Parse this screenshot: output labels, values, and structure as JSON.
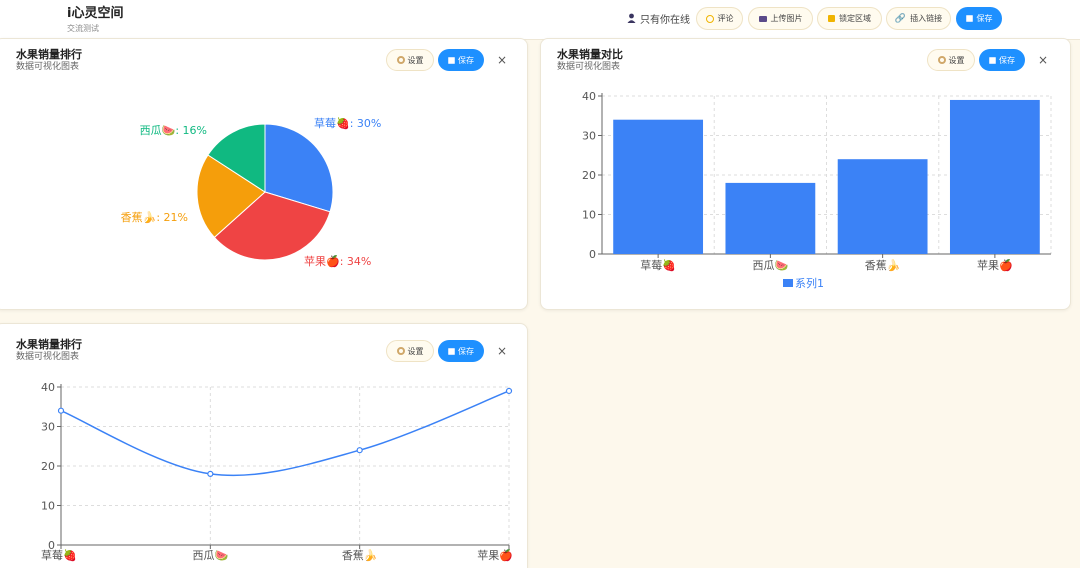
{
  "header": {
    "title": "i心灵空间",
    "subtitle": "交流测试",
    "online_text": "只有你在线",
    "buttons": {
      "comment": "评论",
      "upload_image": "上传图片",
      "lock_area": "锁定区域",
      "insert_link": "插入链接",
      "save": "保存"
    }
  },
  "cards": [
    {
      "title": "水果销量排行",
      "subtitle": "数据可视化图表",
      "settings_label": "设置",
      "save_label": "保存",
      "close_label": "×"
    },
    {
      "title": "水果销量对比",
      "subtitle": "数据可视化图表",
      "settings_label": "设置",
      "save_label": "保存",
      "close_label": "×"
    },
    {
      "title": "水果销量排行",
      "subtitle": "数据可视化图表",
      "settings_label": "设置",
      "save_label": "保存",
      "close_label": "×"
    }
  ],
  "chart_data": [
    {
      "type": "pie",
      "categories": [
        "草莓🍓",
        "苹果🍎",
        "香蕉🍌",
        "西瓜🍉"
      ],
      "values": [
        30,
        34,
        21,
        16
      ],
      "labels": [
        "草莓🍓: 30%",
        "苹果🍎: 34%",
        "香蕉🍌: 21%",
        "西瓜🍉: 16%"
      ],
      "colors": [
        "#3b82f6",
        "#ef4444",
        "#f59e0b",
        "#10b981"
      ]
    },
    {
      "type": "bar",
      "categories": [
        "草莓🍓",
        "西瓜🍉",
        "香蕉🍌",
        "苹果🍎"
      ],
      "series": [
        {
          "name": "系列1",
          "values": [
            34,
            18,
            24,
            39
          ]
        }
      ],
      "ylim": [
        0,
        40
      ],
      "yticks": [
        "0",
        "10",
        "20",
        "30",
        "40"
      ],
      "grid": true,
      "legend": "bottom",
      "color": "#3b82f6"
    },
    {
      "type": "line",
      "categories": [
        "草莓🍓",
        "西瓜🍉",
        "香蕉🍌",
        "苹果🍎"
      ],
      "values": [
        34,
        18,
        24,
        39
      ],
      "ylim": [
        0,
        40
      ],
      "yticks": [
        "0",
        "10",
        "20",
        "30",
        "40"
      ],
      "grid": true,
      "color": "#3b82f6"
    }
  ]
}
